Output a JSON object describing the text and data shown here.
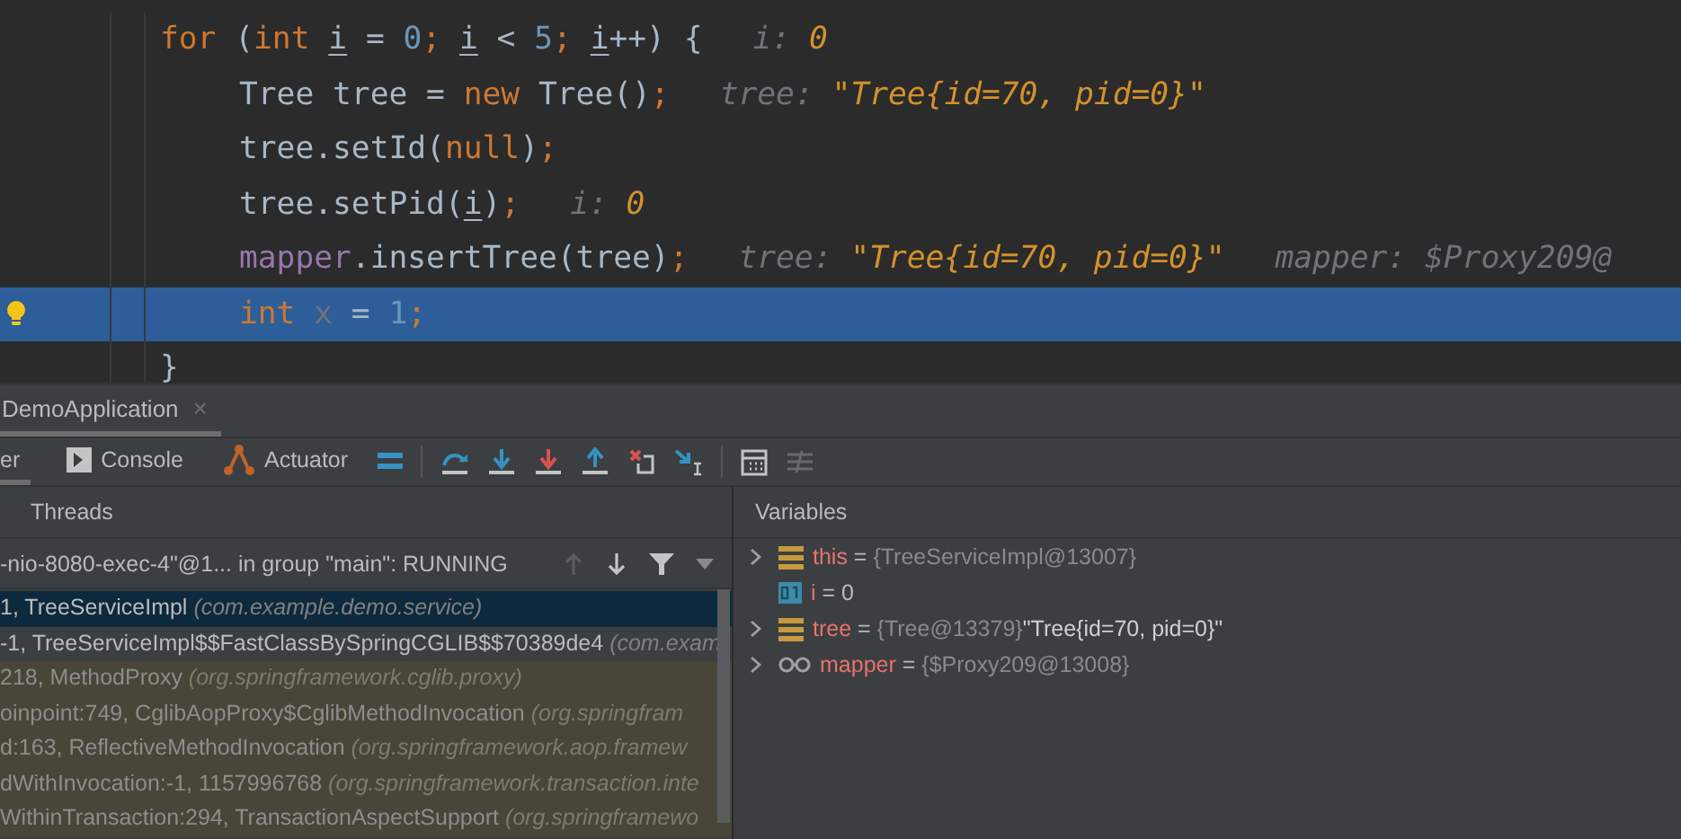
{
  "editor": {
    "lines": [
      {
        "current": false,
        "tokens": [
          {
            "t": "for",
            "kind": "kw"
          },
          {
            "t": " (",
            "kind": "id"
          },
          {
            "t": "int ",
            "kind": "kw"
          },
          {
            "t": "i",
            "kind": "uvar"
          },
          {
            "t": " = ",
            "kind": "id"
          },
          {
            "t": "0",
            "kind": "num"
          },
          {
            "t": "; ",
            "kind": "kw"
          },
          {
            "t": "i",
            "kind": "uvar"
          },
          {
            "t": " < ",
            "kind": "id"
          },
          {
            "t": "5",
            "kind": "num"
          },
          {
            "t": "; ",
            "kind": "kw"
          },
          {
            "t": "i",
            "kind": "uvar"
          },
          {
            "t": "++) {",
            "kind": "id"
          }
        ],
        "hints": [
          {
            "label": "i:",
            "value": "0"
          }
        ],
        "children": [
          {
            "current": false,
            "tokens": [
              {
                "t": "Tree tree = ",
                "kind": "id"
              },
              {
                "t": "new",
                "kind": "kw"
              },
              {
                "t": " Tree()",
                "kind": "id"
              },
              {
                "t": ";",
                "kind": "kw"
              }
            ],
            "hints": [
              {
                "label": "tree:",
                "value": "\"Tree{id=70, pid=0}\""
              }
            ]
          },
          {
            "current": false,
            "tokens": [
              {
                "t": "tree.setId(",
                "kind": "id"
              },
              {
                "t": "null",
                "kind": "kw"
              },
              {
                "t": ")",
                "kind": "id"
              },
              {
                "t": ";",
                "kind": "kw"
              }
            ]
          },
          {
            "current": false,
            "tokens": [
              {
                "t": "tree.setPid(",
                "kind": "id"
              },
              {
                "t": "i",
                "kind": "uvar"
              },
              {
                "t": ")",
                "kind": "id"
              },
              {
                "t": ";",
                "kind": "kw"
              }
            ],
            "hints": [
              {
                "label": "i:",
                "value": "0"
              }
            ]
          },
          {
            "current": false,
            "tokens": [
              {
                "t": "mapper",
                "kind": "field"
              },
              {
                "t": ".insertTree(tree)",
                "kind": "id"
              },
              {
                "t": ";",
                "kind": "kw"
              }
            ],
            "hints": [
              {
                "label": "tree:",
                "value": "\"Tree{id=70, pid=0}\""
              },
              {
                "label": "mapper:",
                "value": "$Proxy209@"
              }
            ]
          },
          {
            "current": true,
            "tokens": [
              {
                "t": "int ",
                "kind": "kw"
              },
              {
                "t": "x",
                "kind": "unused"
              },
              {
                "t": " = ",
                "kind": "id"
              },
              {
                "t": "1",
                "kind": "num"
              },
              {
                "t": ";",
                "kind": "kw"
              }
            ]
          }
        ]
      },
      {
        "current": false,
        "tokens": [
          {
            "t": "}",
            "kind": "id"
          }
        ]
      }
    ]
  },
  "run_tab": {
    "label": "DemoApplication",
    "close": "×"
  },
  "tool_tabs": [
    {
      "label": "er",
      "selected": true,
      "kind": "plain"
    },
    {
      "label": "Console",
      "selected": false,
      "kind": "console"
    },
    {
      "label": "Actuator",
      "selected": false,
      "kind": "actuator"
    }
  ],
  "frames": {
    "header": "Threads",
    "thread": "-nio-8080-exec-4\"@1... in group \"main\": RUNNING",
    "rows": [
      {
        "method": "1, TreeServiceImpl",
        "package": "(com.example.demo.service)",
        "selected": true,
        "kind": "app"
      },
      {
        "method": "-1, TreeServiceImpl$$FastClassBySpringCGLIB$$70389de4",
        "package": "(com.exam",
        "selected": false,
        "kind": "app"
      },
      {
        "method": "218, MethodProxy",
        "package": "(org.springframework.cglib.proxy)",
        "selected": false,
        "kind": "library"
      },
      {
        "method": "oinpoint:749, CglibAopProxy$CglibMethodInvocation",
        "package": "(org.springfram",
        "selected": false,
        "kind": "library"
      },
      {
        "method": "d:163, ReflectiveMethodInvocation",
        "package": "(org.springframework.aop.framew",
        "selected": false,
        "kind": "library"
      },
      {
        "method": "dWithInvocation:-1, 1157996768",
        "package": "(org.springframework.transaction.inte",
        "selected": false,
        "kind": "library"
      },
      {
        "method": "WithinTransaction:294, TransactionAspectSupport",
        "package": "(org.springframewo",
        "selected": false,
        "kind": "library"
      }
    ]
  },
  "variables": {
    "header": "Variables",
    "items": [
      {
        "kind": "object",
        "expandable": true,
        "name": "this",
        "operator": "=",
        "value": "{TreeServiceImpl@13007}"
      },
      {
        "kind": "primitive",
        "expandable": false,
        "name": "i",
        "operator": "=",
        "value": "0"
      },
      {
        "kind": "object",
        "expandable": true,
        "name": "tree",
        "operator": "=",
        "value": "{Tree@13379}",
        "string": "\"Tree{id=70, pid=0}\""
      },
      {
        "kind": "watch",
        "expandable": true,
        "name": "mapper",
        "operator": "=",
        "value": "{$Proxy209@13008}"
      }
    ]
  }
}
